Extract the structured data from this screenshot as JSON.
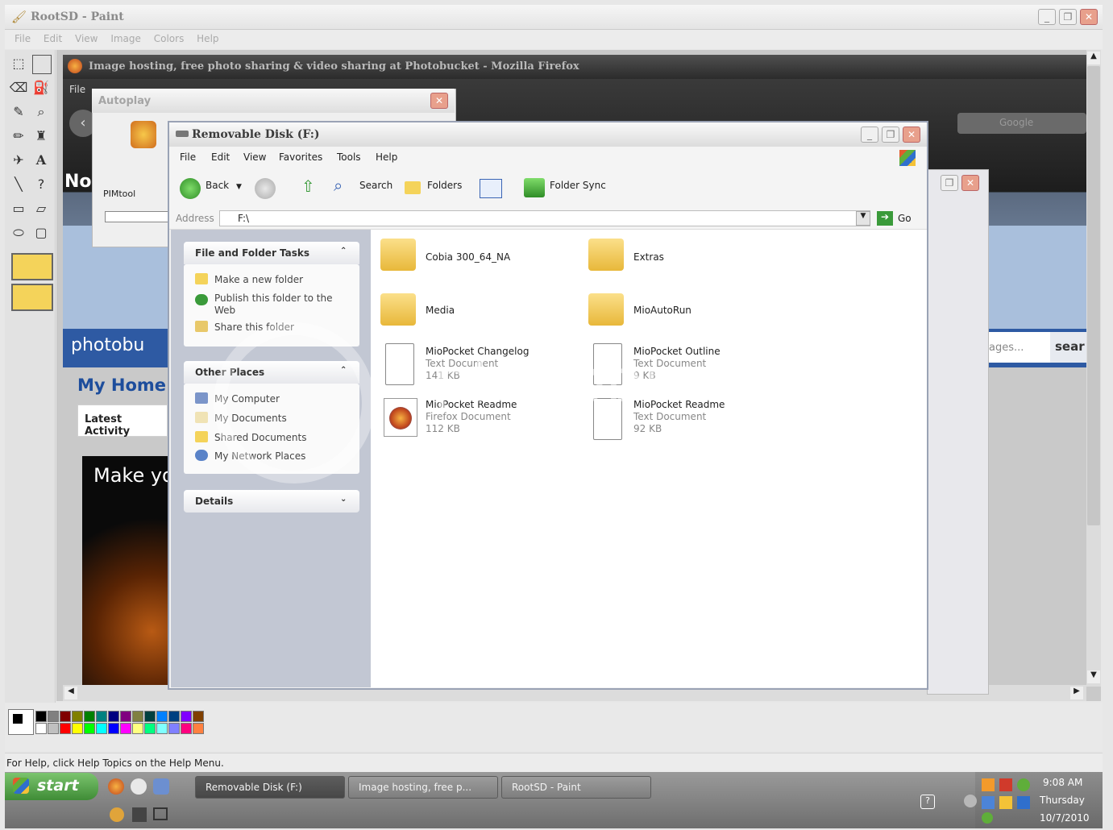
{
  "paint": {
    "title": "RootSD - Paint",
    "menu": [
      "File",
      "Edit",
      "View",
      "Image",
      "Colors",
      "Help"
    ],
    "status": "For Help, click Help Topics on the Help Menu."
  },
  "firefox": {
    "title": "Image hosting, free photo sharing & video sharing at Photobucket - Mozilla Firefox",
    "menu_file": "File",
    "search_engine": "Google",
    "partial_no": "No",
    "logo": "photobu",
    "my_home": "My Home /",
    "latest_activity": "Latest Activity",
    "promo_text": "Make yo",
    "search_placeholder": "ages...",
    "search_button": "sear",
    "go": "Go"
  },
  "autoplay": {
    "title": "Autoplay",
    "app_label": "PIMtool"
  },
  "explorer": {
    "title": "Removable Disk (F:)",
    "menu": [
      "File",
      "Edit",
      "View",
      "Favorites",
      "Tools",
      "Help"
    ],
    "toolbar": {
      "back": "Back",
      "search": "Search",
      "folders": "Folders",
      "folder_sync": "Folder Sync"
    },
    "address_label": "Address",
    "address": "F:\\",
    "go": "Go",
    "tasks": {
      "title": "File and Folder Tasks",
      "items": [
        "Make a new folder",
        "Publish this folder to the Web",
        "Share this folder"
      ]
    },
    "places": {
      "title": "Other Places",
      "items": [
        "My Computer",
        "My Documents",
        "Shared Documents",
        "My Network Places"
      ]
    },
    "details": {
      "title": "Details"
    },
    "files": [
      {
        "name": "Cobia 300_64_NA",
        "kind": "folder"
      },
      {
        "name": "Extras",
        "kind": "folder"
      },
      {
        "name": "Media",
        "kind": "folder"
      },
      {
        "name": "MioAutoRun",
        "kind": "folder"
      },
      {
        "name": "MioPocket Changelog",
        "type": "Text Document",
        "size": "141 KB",
        "kind": "text"
      },
      {
        "name": "MioPocket Outline",
        "type": "Text Document",
        "size": "9 KB",
        "kind": "text"
      },
      {
        "name": "MioPocket Readme",
        "type": "Firefox Document",
        "size": "112 KB",
        "kind": "firefox"
      },
      {
        "name": "MioPocket Readme",
        "type": "Text Document",
        "size": "92 KB",
        "kind": "text"
      }
    ]
  },
  "watermark": {
    "line1": "photobucket",
    "line2": "host. store. share."
  },
  "taskbar": {
    "start": "start",
    "tasks": [
      "Removable Disk (F:)",
      "Image hosting, free p...",
      "RootSD - Paint"
    ],
    "time": "9:08 AM",
    "day": "Thursday",
    "date": "10/7/2010"
  },
  "palette": [
    "#000000",
    "#808080",
    "#800000",
    "#808000",
    "#008000",
    "#008080",
    "#000080",
    "#800080",
    "#808040",
    "#004040",
    "#0080ff",
    "#004080",
    "#8000ff",
    "#804000",
    "#ffffff",
    "#c0c0c0",
    "#ff0000",
    "#ffff00",
    "#00ff00",
    "#00ffff",
    "#0000ff",
    "#ff00ff",
    "#ffff80",
    "#00ff80",
    "#80ffff",
    "#8080ff",
    "#ff0080",
    "#ff8040"
  ]
}
